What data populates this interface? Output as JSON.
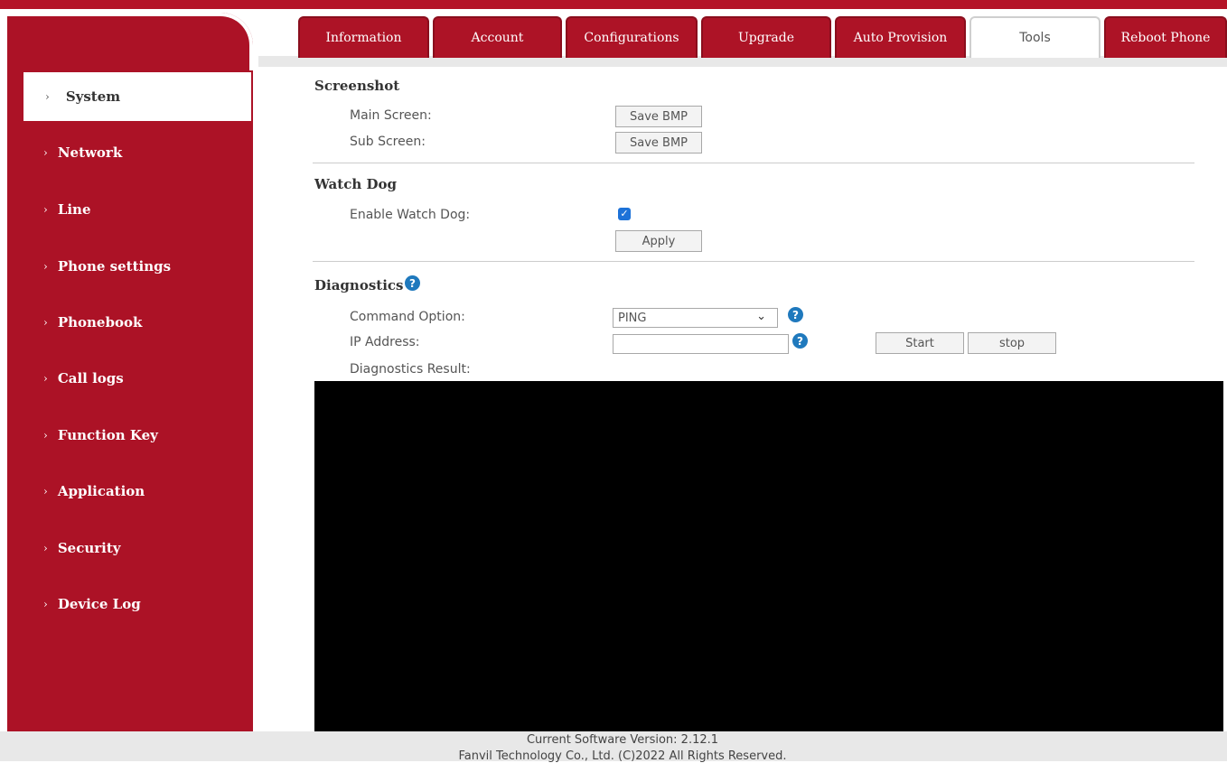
{
  "tabs": [
    {
      "label": "Information"
    },
    {
      "label": "Account"
    },
    {
      "label": "Configurations"
    },
    {
      "label": "Upgrade"
    },
    {
      "label": "Auto Provision"
    },
    {
      "label": "Tools"
    },
    {
      "label": "Reboot Phone"
    }
  ],
  "active_tab": "Tools",
  "sidebar": {
    "items": [
      {
        "label": "System"
      },
      {
        "label": "Network"
      },
      {
        "label": "Line"
      },
      {
        "label": "Phone settings"
      },
      {
        "label": "Phonebook"
      },
      {
        "label": "Call logs"
      },
      {
        "label": "Function Key"
      },
      {
        "label": "Application"
      },
      {
        "label": "Security"
      },
      {
        "label": "Device Log"
      }
    ],
    "active": "System",
    "chevron": "›"
  },
  "screenshot": {
    "title": "Screenshot",
    "main_label": "Main Screen:",
    "sub_label": "Sub Screen:",
    "save_label": "Save BMP"
  },
  "watchdog": {
    "title": "Watch Dog",
    "enable_label": "Enable Watch Dog:",
    "enabled": true,
    "apply_label": "Apply"
  },
  "diagnostics": {
    "title": "Diagnostics",
    "command_label": "Command Option:",
    "command_value": "PING",
    "ip_label": "IP Address:",
    "ip_value": "",
    "start_label": "Start",
    "stop_label": "stop",
    "result_label": "Diagnostics Result:"
  },
  "footer": {
    "version": "Current Software Version: 2.12.1",
    "copyright": "Fanvil Technology Co., Ltd. (C)2022 All Rights Reserved."
  },
  "colors": {
    "brand_red": "#ad1326",
    "help_blue": "#1f79bd",
    "checkbox_blue": "#1d72d8"
  },
  "icons": {
    "help": "question-circle-icon",
    "check": "checkmark-icon",
    "chevron": "chevron-right-icon",
    "caret": "chevron-down-icon"
  }
}
